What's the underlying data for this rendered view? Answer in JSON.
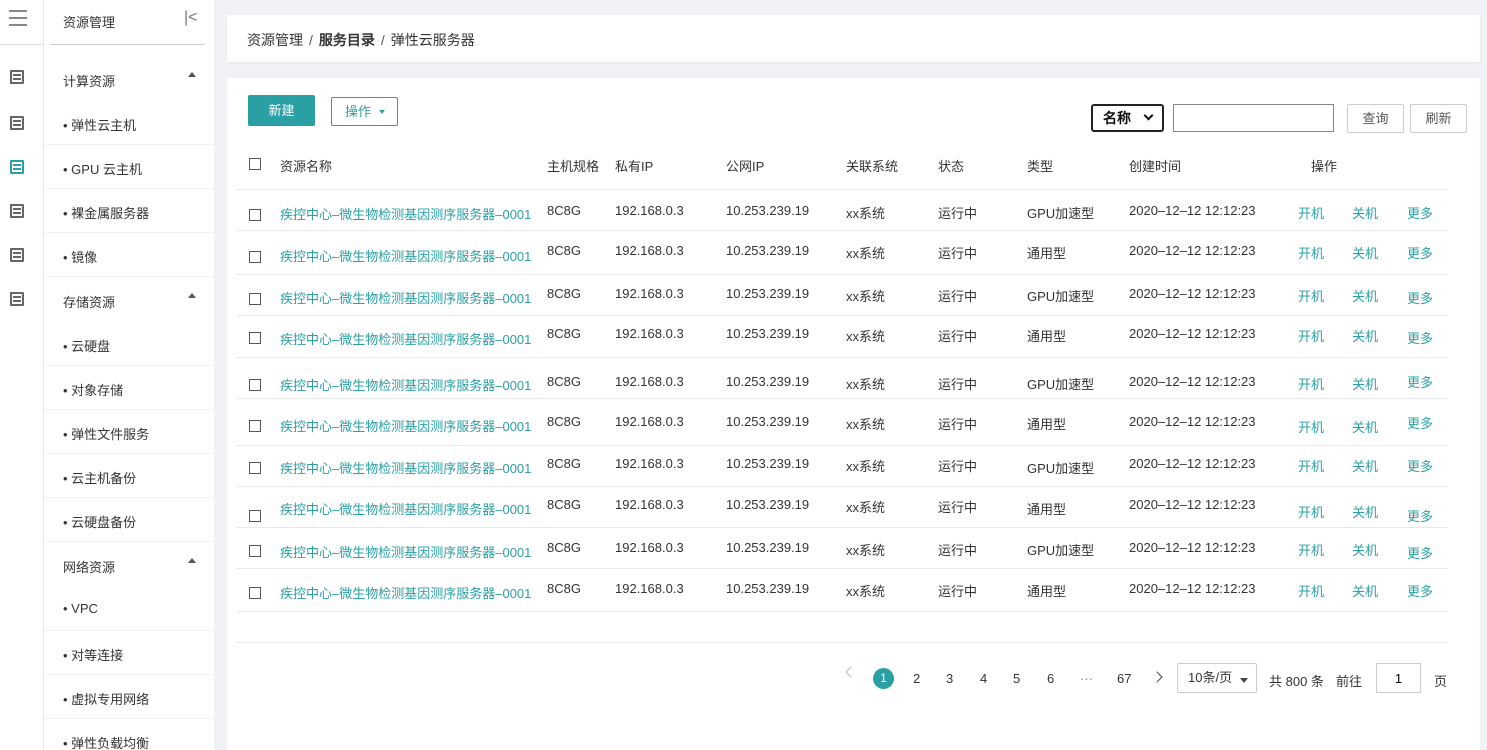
{
  "rail": {
    "icons": [
      "hamburger-icon",
      "list-icon",
      "list-icon",
      "list-icon-active",
      "list-icon",
      "list-icon",
      "list-icon"
    ]
  },
  "sidebar": {
    "title": "资源管理",
    "collapse_icon": "|<",
    "items": [
      {
        "label": "计算资源",
        "type": "group"
      },
      {
        "label": "• 弹性云主机",
        "type": "sub"
      },
      {
        "label": "• GPU 云主机",
        "type": "sub"
      },
      {
        "label": "• 裸金属服务器",
        "type": "sub"
      },
      {
        "label": "• 镜像",
        "type": "sub"
      },
      {
        "label": "存储资源",
        "type": "group"
      },
      {
        "label": "• 云硬盘",
        "type": "sub"
      },
      {
        "label": "• 对象存储",
        "type": "sub"
      },
      {
        "label": "• 弹性文件服务",
        "type": "sub"
      },
      {
        "label": "• 云主机备份",
        "type": "sub"
      },
      {
        "label": "• 云硬盘备份",
        "type": "sub"
      },
      {
        "label": "网络资源",
        "type": "group"
      },
      {
        "label": "• VPC",
        "type": "sub"
      },
      {
        "label": "• 对等连接",
        "type": "sub"
      },
      {
        "label": "• 虚拟专用网络",
        "type": "sub"
      },
      {
        "label": "• 弹性负载均衡",
        "type": "sub"
      }
    ]
  },
  "breadcrumb": {
    "part1": "资源管理",
    "part2": "服务目录",
    "part3": "弹性云服务器",
    "sep": "/"
  },
  "toolbar": {
    "new_label": "新建",
    "ops_label": "操作",
    "filter_select": "名称",
    "search_value": "",
    "query_label": "查询",
    "refresh_label": "刷新"
  },
  "table": {
    "headers": {
      "name": "资源名称",
      "spec": "主机规格",
      "private_ip": "私有IP",
      "public_ip": "公网IP",
      "system": "关联系统",
      "status": "状态",
      "type": "类型",
      "created": "创建时间",
      "ops": "操作"
    },
    "rows": [
      {
        "name": "疾控中心–微生物检测基因测序服务器–0001",
        "spec": "8C8G",
        "private_ip": "192.168.0.3",
        "public_ip": "10.253.239.19",
        "system": "xx系统",
        "status": "运行中",
        "type": "GPU加速型",
        "created": "2020–12–12  12:12:23",
        "op_on": "开机",
        "op_off": "关机",
        "op_more": "更多"
      },
      {
        "name": "疾控中心–微生物检测基因测序服务器–0001",
        "spec": "8C8G",
        "private_ip": "192.168.0.3",
        "public_ip": "10.253.239.19",
        "system": "xx系统",
        "status": "运行中",
        "type": "通用型",
        "created": "2020–12–12  12:12:23",
        "op_on": "开机",
        "op_off": "关机",
        "op_more": "更多"
      },
      {
        "name": "疾控中心–微生物检测基因测序服务器–0001",
        "spec": "8C8G",
        "private_ip": "192.168.0.3",
        "public_ip": "10.253.239.19",
        "system": "xx系统",
        "status": "运行中",
        "type": "GPU加速型",
        "created": "2020–12–12  12:12:23",
        "op_on": "开机",
        "op_off": "关机",
        "op_more": "更多"
      },
      {
        "name": "疾控中心–微生物检测基因测序服务器–0001",
        "spec": "8C8G",
        "private_ip": "192.168.0.3",
        "public_ip": "10.253.239.19",
        "system": "xx系统",
        "status": "运行中",
        "type": "通用型",
        "created": "2020–12–12  12:12:23",
        "op_on": "开机",
        "op_off": "关机",
        "op_more": "更多"
      },
      {
        "name": "疾控中心–微生物检测基因测序服务器–0001",
        "spec": "8C8G",
        "private_ip": "192.168.0.3",
        "public_ip": "10.253.239.19",
        "system": "xx系统",
        "status": "运行中",
        "type": "GPU加速型",
        "created": "2020–12–12  12:12:23",
        "op_on": "开机",
        "op_off": "关机",
        "op_more": "更多"
      },
      {
        "name": "疾控中心–微生物检测基因测序服务器–0001",
        "spec": "8C8G",
        "private_ip": "192.168.0.3",
        "public_ip": "10.253.239.19",
        "system": "xx系统",
        "status": "运行中",
        "type": "通用型",
        "created": "2020–12–12  12:12:23",
        "op_on": "开机",
        "op_off": "关机",
        "op_more": "更多"
      },
      {
        "name": "疾控中心–微生物检测基因测序服务器–0001",
        "spec": "8C8G",
        "private_ip": "192.168.0.3",
        "public_ip": "10.253.239.19",
        "system": "xx系统",
        "status": "运行中",
        "type": "GPU加速型",
        "created": "2020–12–12  12:12:23",
        "op_on": "开机",
        "op_off": "关机",
        "op_more": "更多"
      },
      {
        "name": "疾控中心–微生物检测基因测序服务器–0001",
        "spec": "8C8G",
        "private_ip": "192.168.0.3",
        "public_ip": "10.253.239.19",
        "system": "xx系统",
        "status": "运行中",
        "type": "通用型",
        "created": "2020–12–12  12:12:23",
        "op_on": "开机",
        "op_off": "关机",
        "op_more": "更多"
      },
      {
        "name": "疾控中心–微生物检测基因测序服务器–0001",
        "spec": "8C8G",
        "private_ip": "192.168.0.3",
        "public_ip": "10.253.239.19",
        "system": "xx系统",
        "status": "运行中",
        "type": "GPU加速型",
        "created": "2020–12–12  12:12:23",
        "op_on": "开机",
        "op_off": "关机",
        "op_more": "更多"
      },
      {
        "name": "疾控中心–微生物检测基因测序服务器–0001",
        "spec": "8C8G",
        "private_ip": "192.168.0.3",
        "public_ip": "10.253.239.19",
        "system": "xx系统",
        "status": "运行中",
        "type": "通用型",
        "created": "2020–12–12  12:12:23",
        "op_on": "开机",
        "op_off": "关机",
        "op_more": "更多"
      }
    ]
  },
  "pagination": {
    "current": "1",
    "pages": [
      "2",
      "3",
      "4",
      "5",
      "6",
      "···",
      "67"
    ],
    "page_size": "10条/页",
    "total": "共 800 条",
    "goto_label": "前往",
    "goto_value": "1",
    "page_suffix": "页"
  },
  "colors": {
    "accent": "#2aa0a4",
    "background": "#f0f2f5"
  }
}
